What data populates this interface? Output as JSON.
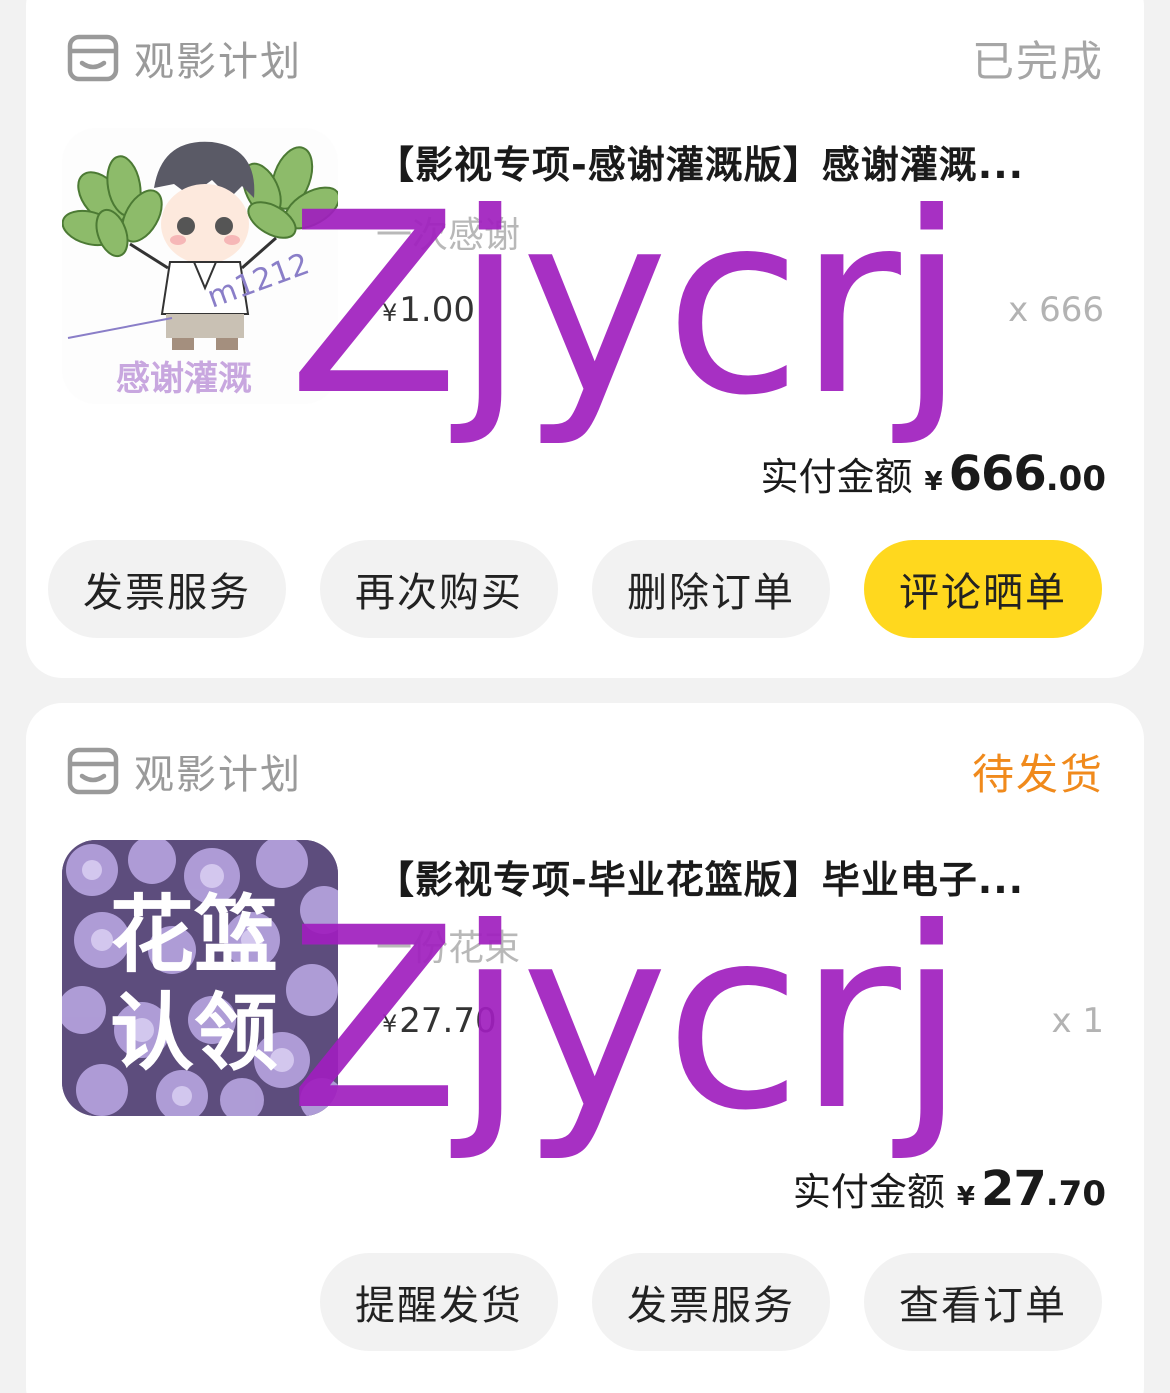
{
  "orders": [
    {
      "shop": {
        "name": "观影计划",
        "icon": "store-icon"
      },
      "status": "已完成",
      "product": {
        "title": "【影视专项-感谢灌溉版】感谢灌溉...",
        "spec": "一次感谢",
        "currency": "¥",
        "price": "1.00",
        "quantity": "x 666",
        "thumb_text": "感谢灌溉",
        "thumb_tag": "m1212"
      },
      "paid": {
        "label": "实付金额",
        "currency": "¥",
        "int": "666",
        "dec": ".00"
      },
      "actions": [
        "发票服务",
        "再次购买",
        "删除订单",
        "评论晒单"
      ],
      "watermark": "Zjycrj"
    },
    {
      "shop": {
        "name": "观影计划",
        "icon": "store-icon"
      },
      "status": "待发货",
      "product": {
        "title": "【影视专项-毕业花篮版】毕业电子...",
        "spec": "一份花束",
        "currency": "¥",
        "price": "27.70",
        "quantity": "x 1",
        "thumb_line1": "花篮",
        "thumb_line2": "认领"
      },
      "paid": {
        "label": "实付金额",
        "currency": "¥",
        "int": "27",
        "dec": ".70"
      },
      "actions": [
        "提醒发货",
        "发票服务",
        "查看订单"
      ],
      "watermark": "Zjycrj"
    }
  ],
  "colors": {
    "primary_button": "#ffd81e",
    "pending_status": "#f08a1c",
    "watermark": "#a01ebe"
  }
}
